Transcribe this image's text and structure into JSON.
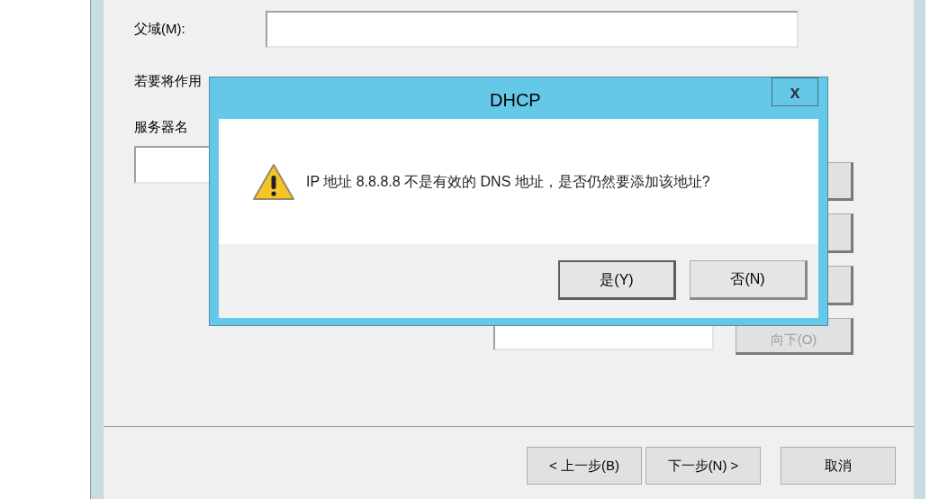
{
  "wizard": {
    "parent_domain": {
      "label": "父域(M):"
    },
    "instruction": "若要将作用",
    "server_name": {
      "label": "服务器名"
    },
    "move_down_button": {
      "label": "向下(O)",
      "disabled": true
    },
    "buttons": [
      {
        "label": "< 上一步(B)"
      },
      {
        "label": "下一步(N) >"
      },
      {
        "label": "取消"
      }
    ]
  },
  "dialog": {
    "title": "DHCP",
    "close": "x",
    "message": "IP 地址 8.8.8.8 不是有效的 DNS 地址，是否仍然要添加该地址?",
    "buttons": [
      {
        "label": "是(Y)",
        "selected": true
      },
      {
        "label": "否(N)",
        "selected": false
      }
    ]
  }
}
